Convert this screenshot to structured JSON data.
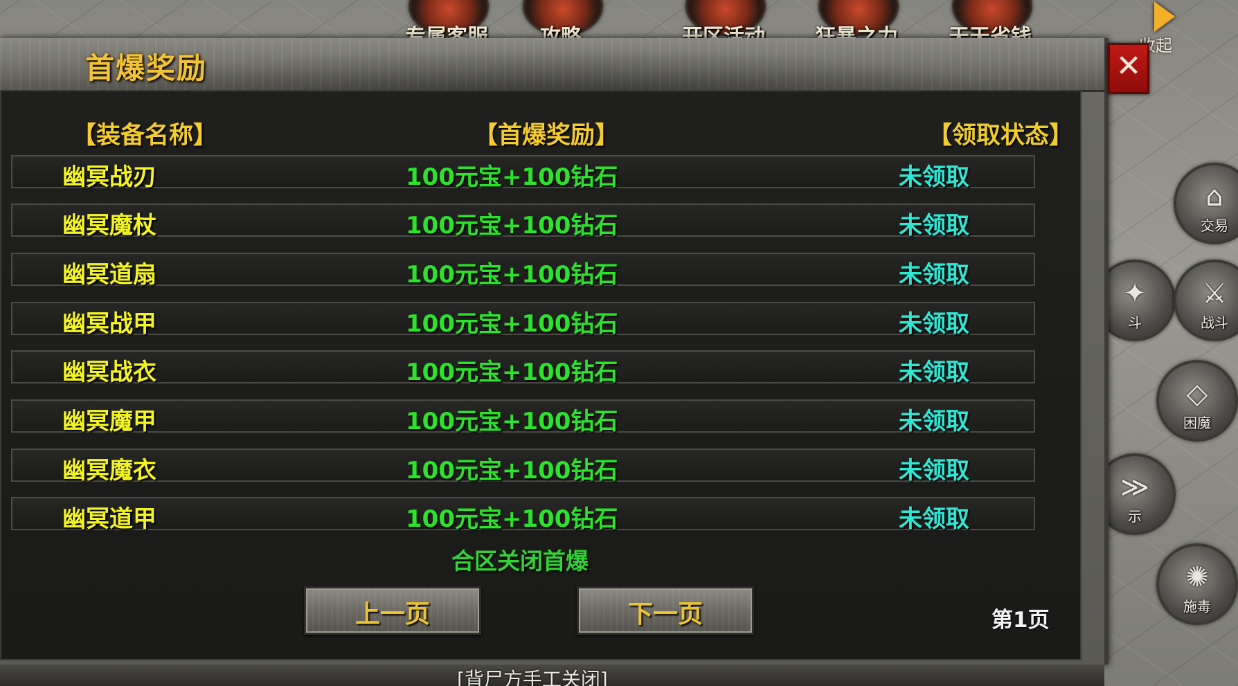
{
  "top_buttons": [
    {
      "label": "专属客服",
      "icon": "service-icon"
    },
    {
      "label": "攻略",
      "icon": "guide-icon"
    },
    {
      "label": "开区活动",
      "icon": "event-icon"
    },
    {
      "label": "狂暴之力",
      "icon": "rage-icon"
    },
    {
      "label": "天天省钱",
      "icon": "coin-icon"
    }
  ],
  "collapse": {
    "label": "收起"
  },
  "side_buttons": [
    {
      "label": "交易",
      "icon": "trade-icon"
    },
    {
      "label": "斗",
      "icon": "fight-icon"
    },
    {
      "label": "战斗",
      "icon": "battle-icon"
    },
    {
      "label": "困魔",
      "icon": "trap-skill-icon"
    },
    {
      "label": "示",
      "icon": "show-icon"
    },
    {
      "label": "施毒",
      "icon": "poison-skill-icon"
    }
  ],
  "dialog": {
    "title": "首爆奖励",
    "close_icon": "✕",
    "headers": {
      "name": "【装备名称】",
      "reward": "【首爆奖励】",
      "status": "【领取状态】"
    },
    "rows": [
      {
        "name": "幽冥战刃",
        "reward": "100元宝+100钻石",
        "status": "未领取"
      },
      {
        "name": "幽冥魔杖",
        "reward": "100元宝+100钻石",
        "status": "未领取"
      },
      {
        "name": "幽冥道扇",
        "reward": "100元宝+100钻石",
        "status": "未领取"
      },
      {
        "name": "幽冥战甲",
        "reward": "100元宝+100钻石",
        "status": "未领取"
      },
      {
        "name": "幽冥战衣",
        "reward": "100元宝+100钻石",
        "status": "未领取"
      },
      {
        "name": "幽冥魔甲",
        "reward": "100元宝+100钻石",
        "status": "未领取"
      },
      {
        "name": "幽冥魔衣",
        "reward": "100元宝+100钻石",
        "status": "未领取"
      },
      {
        "name": "幽冥道甲",
        "reward": "100元宝+100钻石",
        "status": "未领取"
      }
    ],
    "notice": "合区关闭首爆",
    "prev_label": "上一页",
    "next_label": "下一页",
    "page_label": "第1页"
  },
  "bottom": {
    "text": "[背尸方手工关闭]"
  },
  "colors": {
    "title_gold": "#f2c335",
    "name_yellow": "#f4f423",
    "reward_green": "#2be32b",
    "status_cyan": "#2ee8d6",
    "close_red": "#c01a15"
  }
}
